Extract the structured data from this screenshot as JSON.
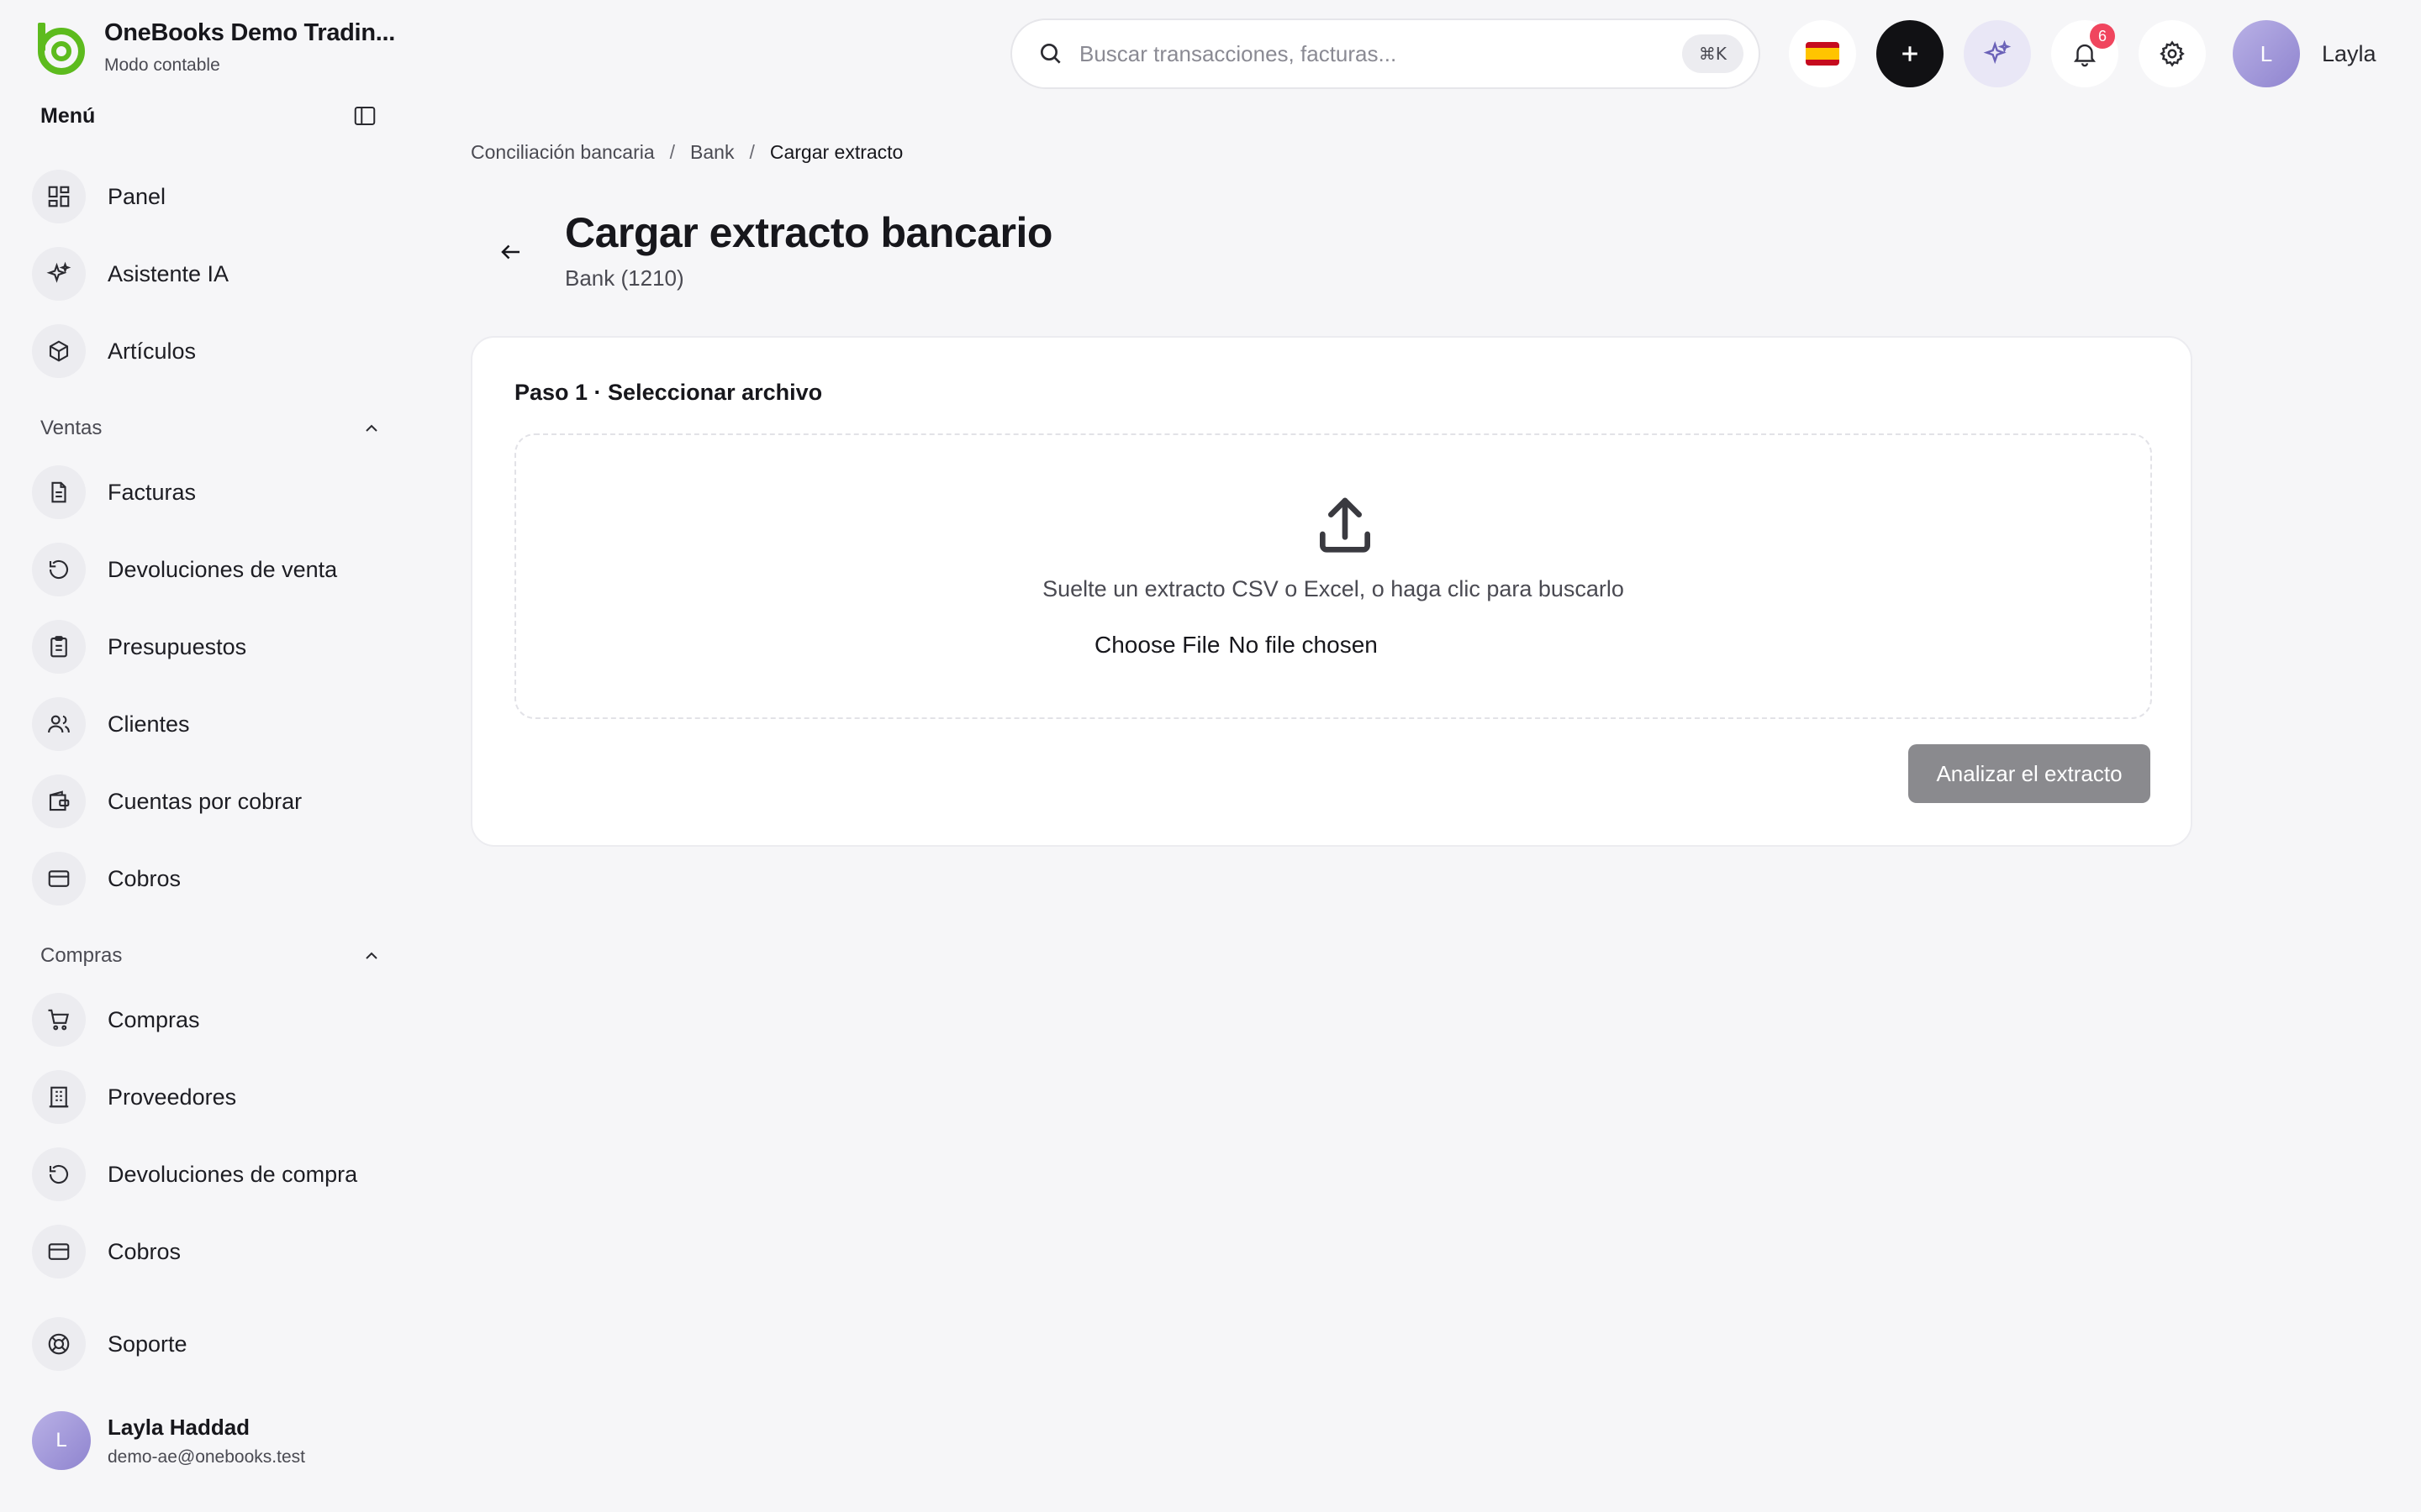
{
  "brand": {
    "title": "OneBooks Demo Tradin...",
    "subtitle": "Modo contable",
    "accent_color": "#5dbb1e"
  },
  "sidebar": {
    "menu_title": "Menú",
    "top_items": [
      {
        "label": "Panel",
        "icon": "dashboard-icon"
      },
      {
        "label": "Asistente IA",
        "icon": "sparkles-icon"
      },
      {
        "label": "Artículos",
        "icon": "box-icon"
      }
    ],
    "sections": [
      {
        "title": "Ventas",
        "expanded": true,
        "items": [
          {
            "label": "Facturas",
            "icon": "document-icon"
          },
          {
            "label": "Devoluciones de venta",
            "icon": "return-icon"
          },
          {
            "label": "Presupuestos",
            "icon": "clipboard-icon"
          },
          {
            "label": "Clientes",
            "icon": "users-icon"
          },
          {
            "label": "Cuentas por cobrar",
            "icon": "wallet-icon"
          },
          {
            "label": "Cobros",
            "icon": "card-icon"
          }
        ]
      },
      {
        "title": "Compras",
        "expanded": true,
        "items": [
          {
            "label": "Compras",
            "icon": "cart-icon"
          },
          {
            "label": "Proveedores",
            "icon": "building-icon"
          },
          {
            "label": "Devoluciones de compra",
            "icon": "return-icon"
          },
          {
            "label": "Cobros",
            "icon": "card-icon"
          }
        ]
      }
    ],
    "support": {
      "label": "Soporte",
      "icon": "lifebuoy-icon"
    },
    "user": {
      "initial": "L",
      "name": "Layla Haddad",
      "email": "demo-ae@onebooks.test"
    }
  },
  "topbar": {
    "search": {
      "placeholder": "Buscar transacciones, facturas...",
      "shortcut": "⌘K"
    },
    "language_flag": "spain-flag-icon",
    "notifications_count": "6",
    "user": {
      "initial": "L",
      "name": "Layla"
    }
  },
  "breadcrumb": [
    "Conciliación bancaria",
    "Bank",
    "Cargar extracto"
  ],
  "page": {
    "title": "Cargar extracto bancario",
    "subtitle": "Bank (1210)"
  },
  "step": {
    "title": "Paso 1 · Seleccionar archivo",
    "drop_text": "Suelte un extracto CSV o Excel, o haga clic para buscarlo",
    "choose_file_label": "Choose File",
    "no_file_label": "No file chosen",
    "analyze_button": "Analizar el extracto"
  }
}
